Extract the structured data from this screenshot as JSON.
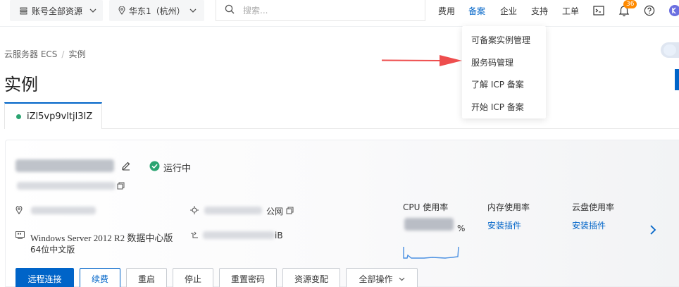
{
  "topbar": {
    "resource_selector": "账号全部资源",
    "region_selector": "华东1（杭州）",
    "search_placeholder": "搜索...",
    "nav": {
      "fees": "费用",
      "beian": "备案",
      "enterprise": "企业",
      "support": "支持",
      "ticket": "工单"
    },
    "notification_count": "36"
  },
  "dropdown": {
    "items": [
      "可备案实例管理",
      "服务码管理",
      "了解 ICP 备案",
      "开始 ICP 备案"
    ]
  },
  "breadcrumb": {
    "root": "云服务器 ECS",
    "separator": "/",
    "current": "实例"
  },
  "page_title": "实例",
  "tab": {
    "label": "iZl5vp9vltjl3IZ"
  },
  "instance": {
    "status": "运行中",
    "ip_suffix": "公网",
    "os_line1": "Windows Server 2012 R2 数据中心版",
    "os_line2": "64位中文版",
    "mem_suffix": "iB"
  },
  "metrics": {
    "cpu_label": "CPU 使用率",
    "cpu_unit": "%",
    "mem_label": "内存使用率",
    "mem_action": "安装插件",
    "disk_label": "云盘使用率",
    "disk_action": "安装插件"
  },
  "actions": {
    "remote": "远程连接",
    "renew": "续费",
    "restart": "重启",
    "stop": "停止",
    "reset_pwd": "重置密码",
    "resize": "资源变配",
    "all_ops": "全部操作"
  },
  "colors": {
    "accent": "#0064c8",
    "running": "#2ba471",
    "arrow": "#ee4d4d",
    "badge": "#ff8a00"
  }
}
